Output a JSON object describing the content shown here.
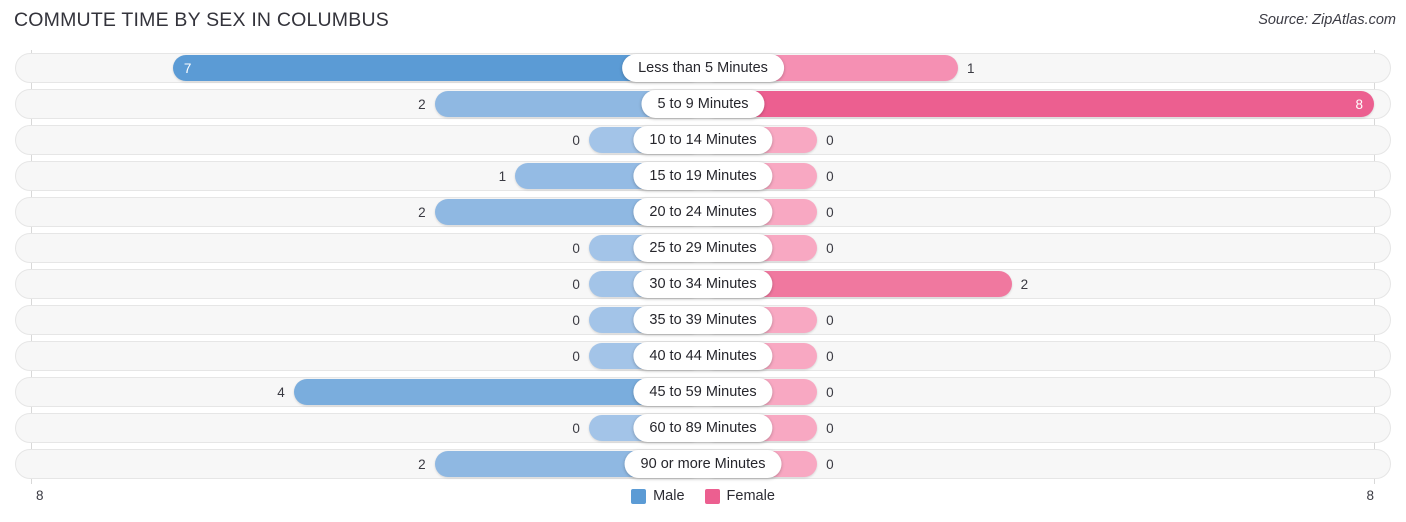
{
  "header": {
    "title": "COMMUTE TIME BY SEX IN COLUMBUS",
    "source": "Source: ZipAtlas.com"
  },
  "axis": {
    "min_label": "8",
    "max_label": "8"
  },
  "legend": {
    "items": [
      {
        "label": "Male",
        "color": "#5b9bd5"
      },
      {
        "label": "Female",
        "color": "#ec5f90"
      }
    ]
  },
  "colors": {
    "male_strong": "#5b9bd5",
    "male_light": "#a3c4e8",
    "female_strong": "#ec5f90",
    "female_light": "#f8a8c2",
    "track_fill": "#f7f7f7",
    "track_border": "#e6e6e6",
    "text": "#3a3a42"
  },
  "chart_data": {
    "type": "bar",
    "orientation": "horizontal-diverging",
    "title": "COMMUTE TIME BY SEX IN COLUMBUS",
    "xlabel": "",
    "ylabel": "",
    "xlim": [
      8,
      8
    ],
    "grid": false,
    "legend_position": "bottom-center",
    "categories": [
      "Less than 5 Minutes",
      "5 to 9 Minutes",
      "10 to 14 Minutes",
      "15 to 19 Minutes",
      "20 to 24 Minutes",
      "25 to 29 Minutes",
      "30 to 34 Minutes",
      "35 to 39 Minutes",
      "40 to 44 Minutes",
      "45 to 59 Minutes",
      "60 to 89 Minutes",
      "90 or more Minutes"
    ],
    "series": [
      {
        "name": "Male",
        "values": [
          7,
          2,
          0,
          1,
          2,
          0,
          0,
          0,
          0,
          4,
          0,
          2
        ]
      },
      {
        "name": "Female",
        "values": [
          1,
          8,
          0,
          0,
          0,
          0,
          2,
          0,
          0,
          0,
          0,
          0
        ]
      }
    ]
  },
  "rows": [
    {
      "category": "Less than 5 Minutes",
      "male": "7",
      "female": "1",
      "male_w": 79,
      "female_w": 38,
      "male_inside": true,
      "female_inside": false,
      "male_color": "#5b9bd5",
      "female_color": "#f590b3"
    },
    {
      "category": "5 to 9 Minutes",
      "male": "2",
      "female": "8",
      "male_w": 40,
      "female_w": 100,
      "male_inside": false,
      "female_inside": true,
      "male_color": "#8fb8e2",
      "female_color": "#ec5f90"
    },
    {
      "category": "10 to 14 Minutes",
      "male": "0",
      "female": "0",
      "male_w": 17,
      "female_w": 17,
      "male_inside": false,
      "female_inside": false,
      "male_color": "#a3c4e8",
      "female_color": "#f8a8c2"
    },
    {
      "category": "15 to 19 Minutes",
      "male": "1",
      "female": "0",
      "male_w": 28,
      "female_w": 17,
      "male_inside": false,
      "female_inside": false,
      "male_color": "#94bbe4",
      "female_color": "#f8a8c2"
    },
    {
      "category": "20 to 24 Minutes",
      "male": "2",
      "female": "0",
      "male_w": 40,
      "female_w": 17,
      "male_inside": false,
      "female_inside": false,
      "male_color": "#8fb8e2",
      "female_color": "#f8a8c2"
    },
    {
      "category": "25 to 29 Minutes",
      "male": "0",
      "female": "0",
      "male_w": 17,
      "female_w": 17,
      "male_inside": false,
      "female_inside": false,
      "male_color": "#a3c4e8",
      "female_color": "#f8a8c2"
    },
    {
      "category": "30 to 34 Minutes",
      "male": "0",
      "female": "2",
      "male_w": 17,
      "female_w": 46,
      "male_inside": false,
      "female_inside": false,
      "male_color": "#a3c4e8",
      "female_color": "#f0789f"
    },
    {
      "category": "35 to 39 Minutes",
      "male": "0",
      "female": "0",
      "male_w": 17,
      "female_w": 17,
      "male_inside": false,
      "female_inside": false,
      "male_color": "#a3c4e8",
      "female_color": "#f8a8c2"
    },
    {
      "category": "40 to 44 Minutes",
      "male": "0",
      "female": "0",
      "male_w": 17,
      "female_w": 17,
      "male_inside": false,
      "female_inside": false,
      "male_color": "#a3c4e8",
      "female_color": "#f8a8c2"
    },
    {
      "category": "45 to 59 Minutes",
      "male": "4",
      "female": "0",
      "male_w": 61,
      "female_w": 17,
      "male_inside": false,
      "female_inside": false,
      "male_color": "#7aaddd",
      "female_color": "#f8a8c2"
    },
    {
      "category": "60 to 89 Minutes",
      "male": "0",
      "female": "0",
      "male_w": 17,
      "female_w": 17,
      "male_inside": false,
      "female_inside": false,
      "male_color": "#a3c4e8",
      "female_color": "#f8a8c2"
    },
    {
      "category": "90 or more Minutes",
      "male": "2",
      "female": "0",
      "male_w": 40,
      "female_w": 17,
      "male_inside": false,
      "female_inside": false,
      "male_color": "#8fb8e2",
      "female_color": "#f8a8c2"
    }
  ]
}
